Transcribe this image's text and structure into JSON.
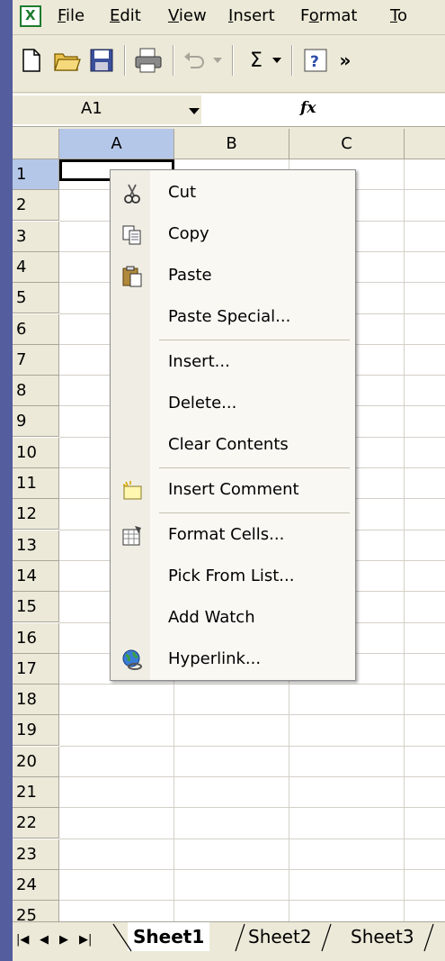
{
  "menubar": {
    "items": [
      {
        "label": "File",
        "accel": "F"
      },
      {
        "label": "Edit",
        "accel": "E"
      },
      {
        "label": "View",
        "accel": "V"
      },
      {
        "label": "Insert",
        "accel": "I"
      },
      {
        "label": "Format",
        "accel": "o"
      },
      {
        "label": "To",
        "accel": "T"
      }
    ]
  },
  "toolbar": {
    "sum_label": "Σ",
    "more_label": "»"
  },
  "formula": {
    "namebox_value": "A1",
    "fx_label": "fx"
  },
  "grid": {
    "columns": [
      "A",
      "B",
      "C"
    ],
    "rows": [
      "1",
      "2",
      "3",
      "4",
      "5",
      "6",
      "7",
      "8",
      "9",
      "10",
      "11",
      "12",
      "13",
      "14",
      "15",
      "16",
      "17",
      "18",
      "19",
      "20",
      "21",
      "22",
      "23",
      "24",
      "25"
    ]
  },
  "context_menu": {
    "items": [
      {
        "name": "cut",
        "label": "Cut",
        "icon": "scissors-icon"
      },
      {
        "name": "copy",
        "label": "Copy",
        "icon": "copy-icon"
      },
      {
        "name": "paste",
        "label": "Paste",
        "icon": "clipboard-icon"
      },
      {
        "name": "paste-special",
        "label": "Paste Special...",
        "icon": ""
      },
      {
        "name": "insert",
        "label": "Insert...",
        "icon": ""
      },
      {
        "name": "delete",
        "label": "Delete...",
        "icon": ""
      },
      {
        "name": "clear-contents",
        "label": "Clear Contents",
        "icon": ""
      },
      {
        "name": "insert-comment",
        "label": "Insert Comment",
        "icon": "comment-icon"
      },
      {
        "name": "format-cells",
        "label": "Format Cells...",
        "icon": "format-cells-icon"
      },
      {
        "name": "pick-from-list",
        "label": "Pick From List...",
        "icon": ""
      },
      {
        "name": "add-watch",
        "label": "Add Watch",
        "icon": ""
      },
      {
        "name": "hyperlink",
        "label": "Hyperlink...",
        "icon": "globe-link-icon"
      }
    ]
  },
  "sheets": {
    "tabs": [
      "Sheet1",
      "Sheet2",
      "Sheet3"
    ],
    "active": "Sheet1"
  }
}
